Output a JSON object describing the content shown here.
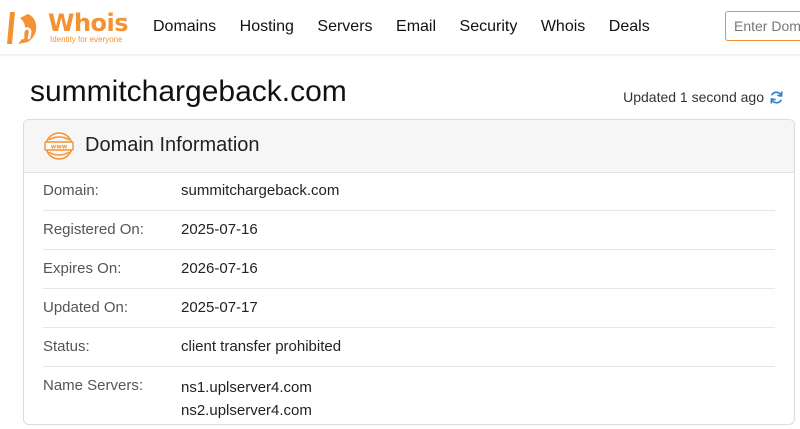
{
  "brand": {
    "name": "Whois",
    "tagline": "Identity for everyone",
    "accent": "#f39232"
  },
  "nav": {
    "items": [
      "Domains",
      "Hosting",
      "Servers",
      "Email",
      "Security",
      "Whois",
      "Deals"
    ]
  },
  "search": {
    "placeholder": "Enter Domain"
  },
  "page": {
    "domain": "summitchargeback.com",
    "updated": "Updated 1 second ago",
    "refresh_icon": "refresh-icon",
    "refresh_color": "#2f83d4"
  },
  "card": {
    "title": "Domain Information",
    "icon": "www-icon",
    "rows": [
      {
        "label": "Domain:",
        "value": "summitchargeback.com"
      },
      {
        "label": "Registered On:",
        "value": "2025-07-16"
      },
      {
        "label": "Expires On:",
        "value": "2026-07-16"
      },
      {
        "label": "Updated On:",
        "value": "2025-07-17"
      },
      {
        "label": "Status:",
        "value": "client transfer prohibited"
      }
    ],
    "name_servers": {
      "label": "Name Servers:",
      "values": [
        "ns1.uplserver4.com",
        "ns2.uplserver4.com"
      ]
    }
  }
}
